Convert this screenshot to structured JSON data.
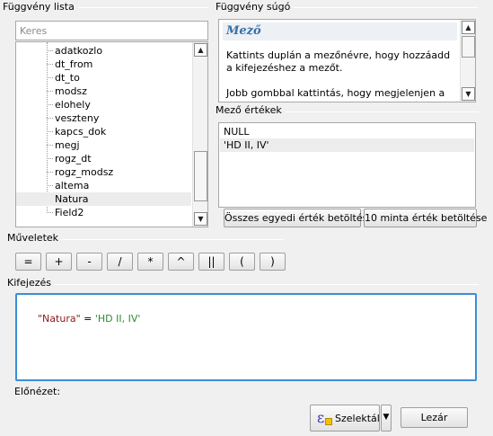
{
  "function_list": {
    "title": "Függvény lista",
    "search_placeholder": "Keres",
    "items": [
      "adatkozlo",
      "dt_from",
      "dt_to",
      "modsz",
      "elohely",
      "veszteny",
      "kapcs_dok",
      "megj",
      "rogz_dt",
      "rogz_modsz",
      "altema",
      "Natura",
      "Field2"
    ],
    "selected": "Natura"
  },
  "function_help": {
    "title": "Függvény súgó",
    "heading": "Mező",
    "paragraph1": "Kattints duplán a mezőnévre, hogy hozzáadd a kifejezéshez a mezőt.",
    "paragraph2": "Jobb gombbal kattintás, hogy megjelenjen a"
  },
  "field_values": {
    "title": "Mező értékek",
    "items": [
      "NULL",
      "'HD II, IV'"
    ],
    "selected": "'HD II, IV'",
    "load_all_button": "Összes egyedi érték betöltése",
    "load_sample_button": "10 minta érték betöltése"
  },
  "operators": {
    "title": "Műveletek",
    "buttons": [
      "=",
      "+",
      "-",
      "/",
      "*",
      "^",
      "||",
      "(",
      ")"
    ]
  },
  "expression": {
    "title": "Kifejezés",
    "field": "\"Natura\"",
    "operator": " = ",
    "value": "'HD II, IV'",
    "colors": {
      "field": "#8b1a1a",
      "value": "#2e8b2e"
    }
  },
  "preview": {
    "label": "Előnézet:"
  },
  "footer": {
    "select_button": "Szelektál",
    "close_button": "Lezár"
  }
}
